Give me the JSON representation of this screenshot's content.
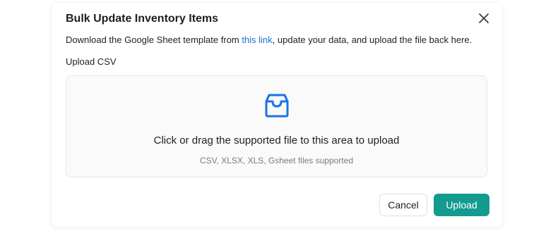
{
  "dialog": {
    "title": "Bulk Update Inventory Items",
    "description": {
      "before_link": "Download the Google Sheet template from ",
      "link_text": "this link",
      "after_link": ", update your data, and upload the file back here."
    },
    "upload_label": "Upload CSV",
    "close_icon": "close-icon"
  },
  "dropzone": {
    "icon": "inbox-icon",
    "main_text": "Click or drag the supported file to this area to upload",
    "hint_text": "CSV, XLSX, XLS, Gsheet files supported"
  },
  "footer": {
    "cancel_label": "Cancel",
    "upload_label": "Upload"
  },
  "colors": {
    "accent": "#149b8f",
    "link": "#1a73c8",
    "icon": "#1a73e8"
  }
}
